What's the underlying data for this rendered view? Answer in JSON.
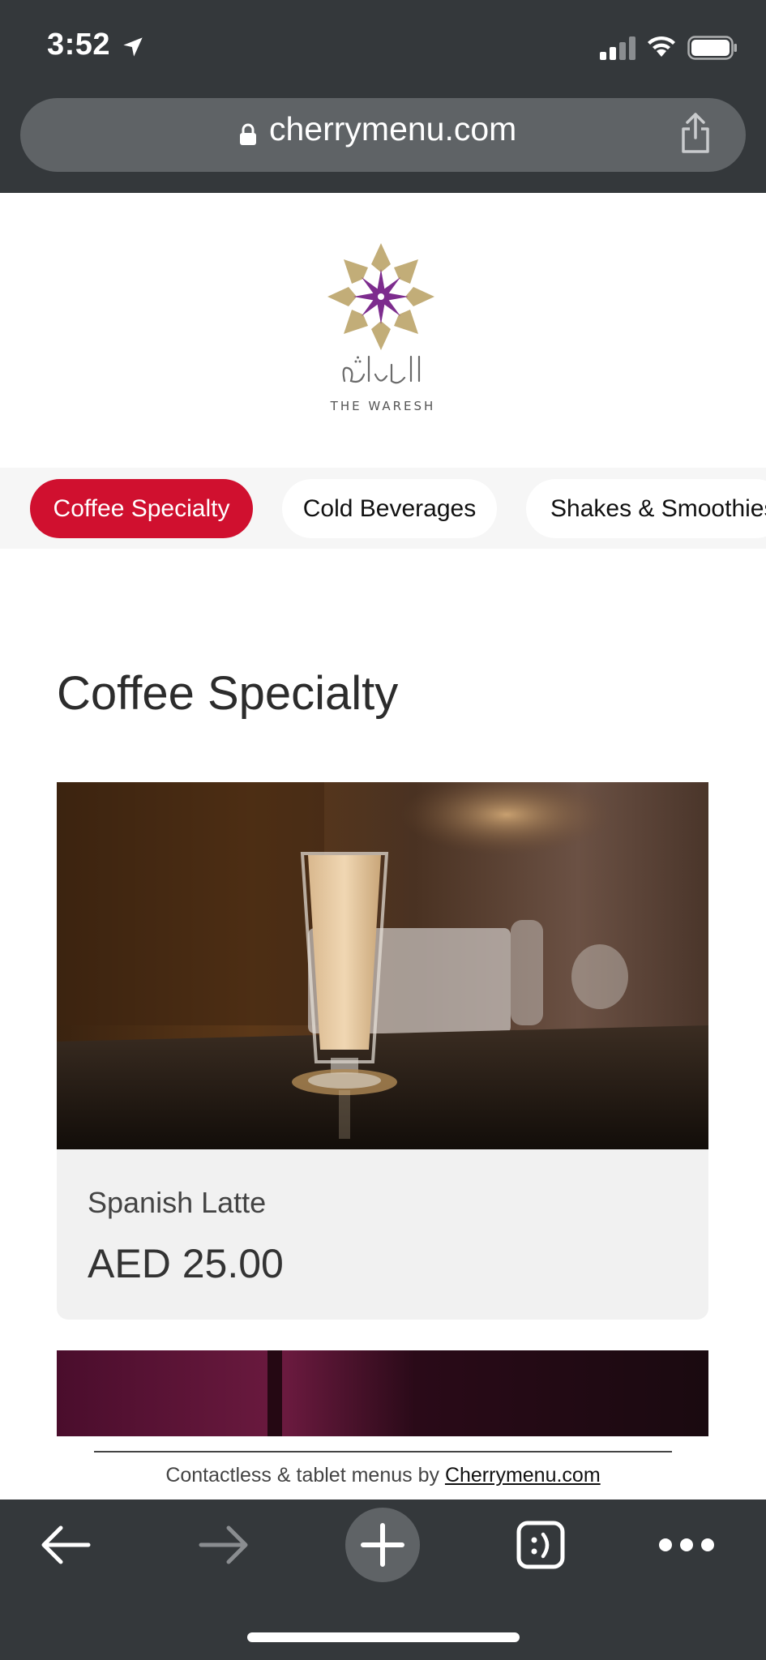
{
  "status_bar": {
    "time": "3:52",
    "icons": [
      "location-arrow-icon",
      "signal-icon",
      "wifi-icon",
      "battery-icon"
    ]
  },
  "address_bar": {
    "url": "cherrymenu.com",
    "icons": [
      "lock-icon",
      "share-icon"
    ]
  },
  "restaurant": {
    "logo_subtitle": "THE WARESH"
  },
  "categories": [
    {
      "label": "Coffee Specialty",
      "active": true
    },
    {
      "label": "Cold Beverages",
      "active": false
    },
    {
      "label": "Shakes & Smoothies",
      "active": false
    }
  ],
  "section": {
    "title": "Coffee Specialty",
    "items": [
      {
        "name": "Spanish Latte",
        "price": "AED 25.00"
      }
    ]
  },
  "footer": {
    "text": "Contactless & tablet menus by",
    "link": "Cherrymenu.com"
  },
  "toolbar": {
    "icons": [
      "back-arrow-icon",
      "forward-arrow-icon",
      "plus-icon",
      "tabs-icon",
      "more-icon"
    ]
  },
  "colors": {
    "chrome": "#34383b",
    "url_bar": "#5f6366",
    "accent": "#d0102f",
    "tab_strip": "#f6f6f6",
    "card": "#f1f1f1",
    "logo_purple": "#7d2c8e",
    "logo_gold": "#c2ad78"
  }
}
